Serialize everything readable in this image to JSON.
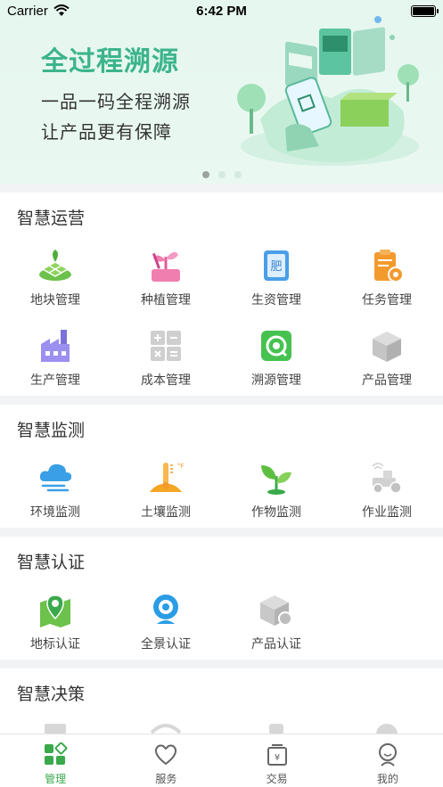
{
  "status_bar": {
    "carrier": "Carrier",
    "time": "6:42 PM"
  },
  "banner": {
    "title": "全过程溯源",
    "line1": "一品一码全程溯源",
    "line2": "让产品更有保障",
    "page_count": 3,
    "active_page": 1
  },
  "sections": [
    {
      "title": "智慧运营",
      "items": [
        {
          "label": "地块管理",
          "icon": "field-plot-icon"
        },
        {
          "label": "种植管理",
          "icon": "planting-icon"
        },
        {
          "label": "生资管理",
          "icon": "fertilizer-icon"
        },
        {
          "label": "任务管理",
          "icon": "task-clipboard-icon"
        },
        {
          "label": "生产管理",
          "icon": "factory-icon"
        },
        {
          "label": "成本管理",
          "icon": "calculator-icon"
        },
        {
          "label": "溯源管理",
          "icon": "trace-scan-icon"
        },
        {
          "label": "产品管理",
          "icon": "product-box-icon"
        }
      ]
    },
    {
      "title": "智慧监测",
      "items": [
        {
          "label": "环境监测",
          "icon": "cloud-wind-icon"
        },
        {
          "label": "土壤监测",
          "icon": "soil-thermometer-icon"
        },
        {
          "label": "作物监测",
          "icon": "sprout-icon"
        },
        {
          "label": "作业监测",
          "icon": "tractor-icon"
        }
      ]
    },
    {
      "title": "智慧认证",
      "items": [
        {
          "label": "地标认证",
          "icon": "map-pin-icon"
        },
        {
          "label": "全景认证",
          "icon": "camera-icon"
        },
        {
          "label": "产品认证",
          "icon": "product-cert-icon"
        }
      ]
    },
    {
      "title": "智慧决策",
      "items": []
    }
  ],
  "tabbar": [
    {
      "label": "管理",
      "icon": "manage-grid-icon",
      "active": true
    },
    {
      "label": "服务",
      "icon": "service-heart-icon",
      "active": false
    },
    {
      "label": "交易",
      "icon": "trade-yen-icon",
      "active": false
    },
    {
      "label": "我的",
      "icon": "profile-icon",
      "active": false
    }
  ],
  "colors": {
    "brand_green": "#3cb48c",
    "tab_active": "#3aa94b",
    "disabled_icon": "#c9c9c9"
  }
}
